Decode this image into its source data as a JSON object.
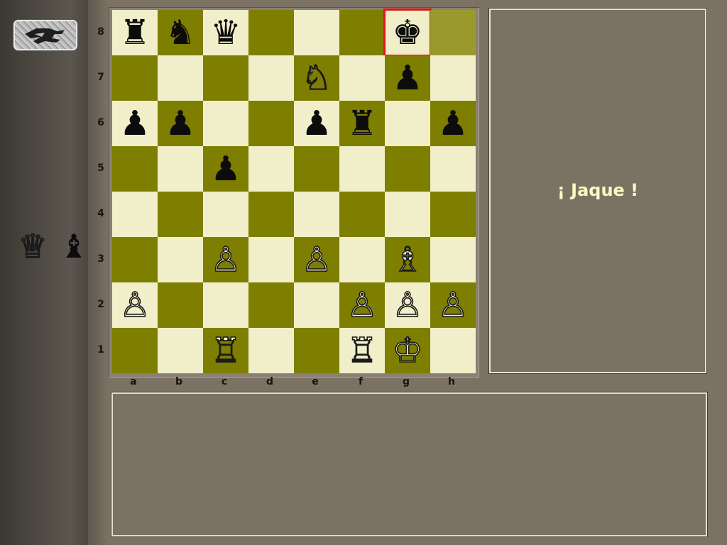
{
  "sidebar": {
    "logo_icon": "knight-logo-icon",
    "captured_pieces": [
      {
        "name": "white-queen-captured-icon",
        "glyph": "♕",
        "color": "white"
      },
      {
        "name": "black-bishop-captured-icon",
        "glyph": "♝",
        "color": "black"
      }
    ]
  },
  "board": {
    "ranks": [
      "8",
      "7",
      "6",
      "5",
      "4",
      "3",
      "2",
      "1"
    ],
    "files": [
      "a",
      "b",
      "c",
      "d",
      "e",
      "f",
      "g",
      "h"
    ],
    "light_color": "#f0efc9",
    "dark_color": "#7e7e00",
    "highlight_color": "#e2141a",
    "check_square": "g8",
    "last_move_square": "h8",
    "pieces": {
      "a8": "♜",
      "b8": "♞",
      "c8": "♛",
      "g8": "♚",
      "e7": "♘",
      "g7": "♟",
      "a6": "♟",
      "b6": "♟",
      "e6": "♟",
      "f6": "♜",
      "h6": "♟",
      "c5": "♟",
      "c3": "♙",
      "e3": "♙",
      "g3": "♗",
      "a2": "♙",
      "f2": "♙",
      "g2": "♙",
      "h2": "♙",
      "c1": "♖",
      "f1": "♖",
      "g1": "♔"
    }
  },
  "message_panel": {
    "text": "¡ Jaque !"
  },
  "moves_panel": {
    "entries": []
  }
}
